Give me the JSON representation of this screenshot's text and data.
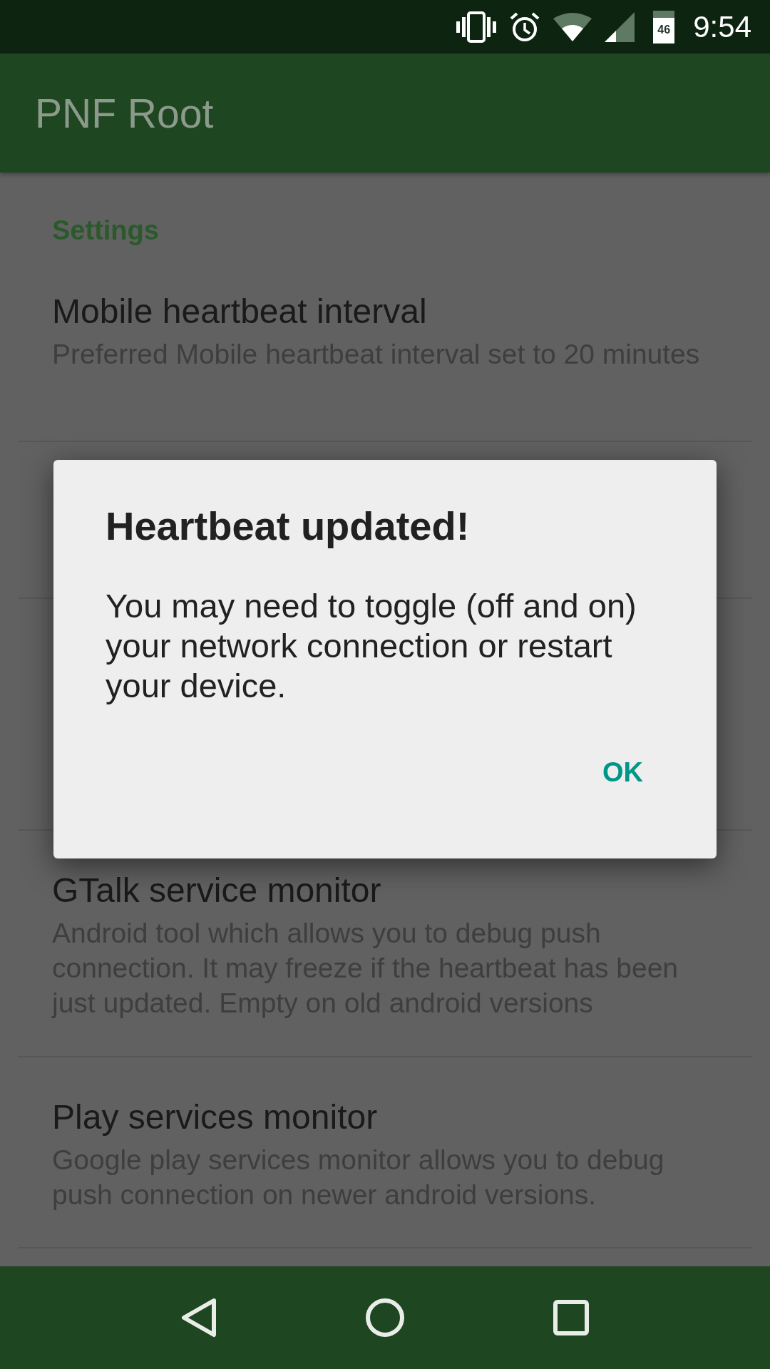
{
  "status_bar": {
    "battery_text": "46",
    "time": "9:54"
  },
  "app_bar": {
    "title": "PNF Root"
  },
  "section": {
    "title": "Settings"
  },
  "settings": [
    {
      "kind": "item",
      "title": "Mobile heartbeat interval",
      "summary": "Preferred Mobile heartbeat interval set to 20 minutes"
    },
    {
      "kind": "hidden"
    },
    {
      "kind": "hidden"
    },
    {
      "kind": "item",
      "title": "GTalk service monitor",
      "summary": "Android tool which allows you to debug push connection. It may freeze if the heartbeat has been just updated. Empty on old android versions"
    },
    {
      "kind": "item",
      "title": "Play services monitor",
      "summary": "Google play services monitor allows you to debug push connection on newer android versions."
    }
  ],
  "dialog": {
    "title": "Heartbeat updated!",
    "message": "You may need to toggle (off and on) your network connection or restart your device.",
    "button": "OK"
  }
}
